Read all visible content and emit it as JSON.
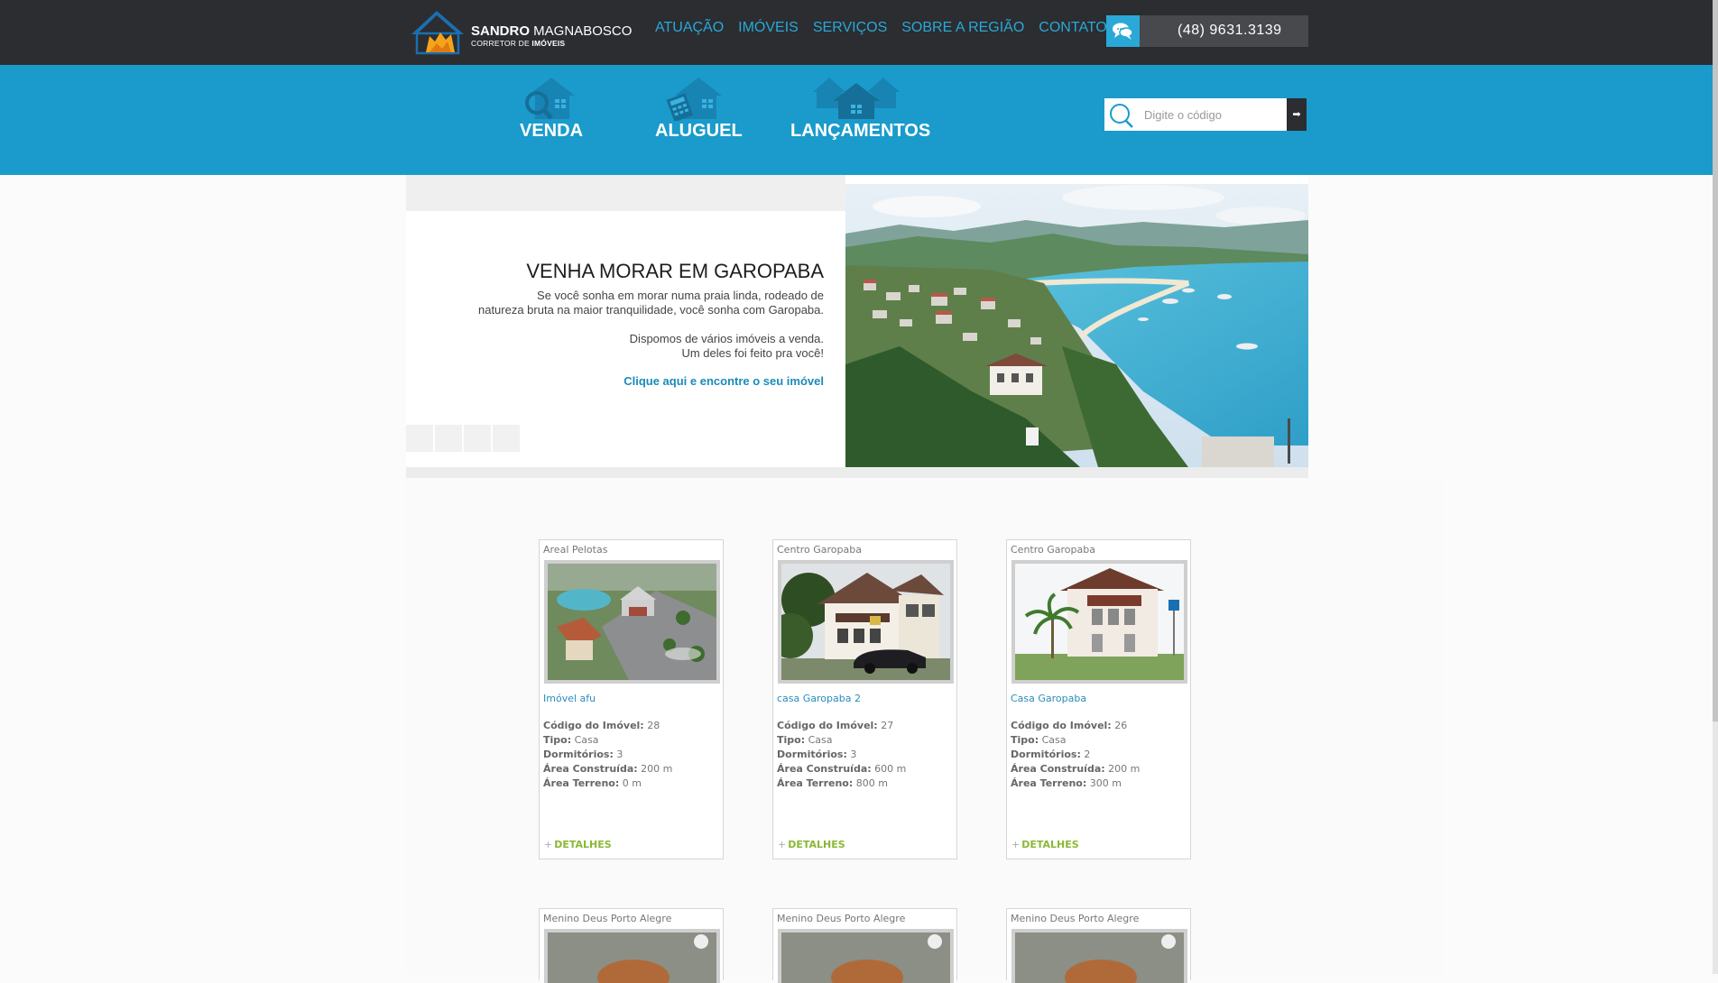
{
  "brand": {
    "name_bold": "SANDRO",
    "name_light": " MAGNABOSCO",
    "subtitle_pre": "CORRETOR DE ",
    "subtitle_bold": "IMÓVEIS"
  },
  "nav": {
    "items": [
      "ATUAÇÃO",
      "IMÓVEIS",
      "SERVIÇOS",
      "SOBRE A REGIÃO",
      "CONTATO"
    ]
  },
  "contact": {
    "phone": "(48) 9631.3139",
    "icon": "chat-bubbles-icon"
  },
  "categories": [
    {
      "label": "VENDA",
      "icon": "house-search-icon"
    },
    {
      "label": "ALUGUEL",
      "icon": "house-calculator-icon"
    },
    {
      "label": "LANÇAMENTOS",
      "icon": "houses-group-icon"
    }
  ],
  "search": {
    "placeholder": "Digite o código",
    "button_icon": "arrow-right-icon"
  },
  "banner": {
    "title": "VENHA MORAR EM GAROPABA",
    "paragraph1_line1": "Se você sonha em morar numa praia linda, rodeado de",
    "paragraph1_line2": "natureza bruta na maior tranquilidade, você sonha com Garopaba.",
    "paragraph2_line1": "Dispomos de vários imóveis a venda.",
    "paragraph2_line2": "Um deles foi feito pra você!",
    "cta": "Clique aqui e encontre o seu imóvel"
  },
  "labels": {
    "code": "Código do Imóvel:",
    "type": "Tipo:",
    "bedrooms": "Dormitórios:",
    "built_area": "Área Construída:",
    "land_area": "Área Terreno:",
    "details": "DETALHES",
    "plus": "+"
  },
  "listings": [
    {
      "location": "Areal Pelotas",
      "title": "Imóvel afu",
      "code": "28",
      "type": "Casa",
      "bedrooms": "3",
      "built_area": "200 m",
      "land_area": "0 m"
    },
    {
      "location": "Centro Garopaba",
      "title": "casa Garopaba 2",
      "code": "27",
      "type": "Casa",
      "bedrooms": "3",
      "built_area": "600 m",
      "land_area": "800 m"
    },
    {
      "location": "Centro Garopaba",
      "title": "Casa Garopaba",
      "code": "26",
      "type": "Casa",
      "bedrooms": "2",
      "built_area": "200 m",
      "land_area": "300 m"
    }
  ],
  "listings_row2": [
    {
      "location": "Menino Deus Porto Alegre"
    },
    {
      "location": "Menino Deus Porto Alegre"
    },
    {
      "location": "Menino Deus Porto Alegre"
    }
  ]
}
